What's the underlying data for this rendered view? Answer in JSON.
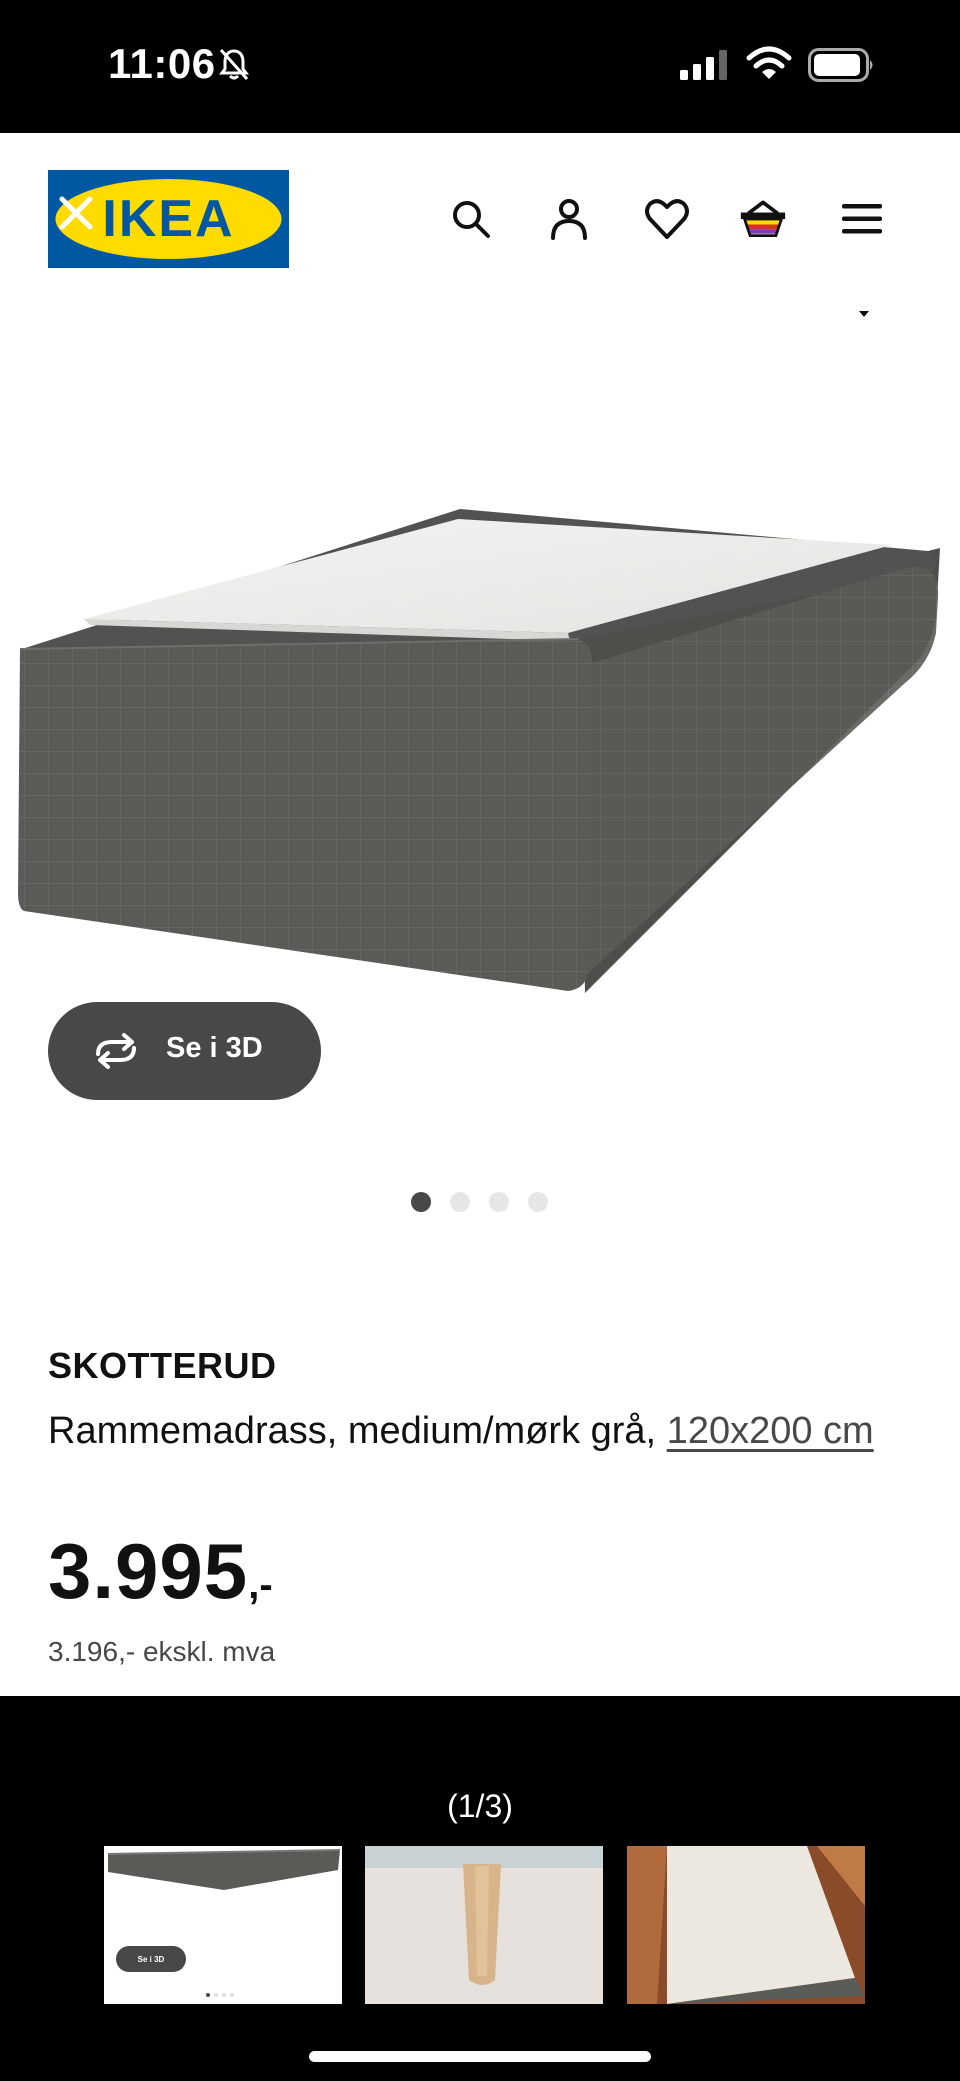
{
  "status_bar": {
    "time": "11:06",
    "icons": [
      "bell-slash-icon",
      "cellular-signal-icon",
      "wifi-icon",
      "battery-icon"
    ]
  },
  "header": {
    "logo_text": "IKEA",
    "icons": [
      "close-icon",
      "search-icon",
      "account-icon",
      "heart-icon",
      "cart-icon",
      "menu-icon"
    ],
    "colors": {
      "logo_blue": "#0058A3",
      "logo_yellow": "#FFDB00"
    }
  },
  "product": {
    "see_3d_label": "Se i 3D",
    "image_count": 4,
    "active_image": 1,
    "name": "SKOTTERUD",
    "description": "Rammemadrass, medium/mørk grå,",
    "size_link": "120x200 cm",
    "price_integer": "3.995",
    "price_suffix": ",-",
    "price_ex_vat": "3.196,- ekskl. mva"
  },
  "gallery": {
    "counter": "(1/3)",
    "thumbnails": [
      {
        "label": "Se i 3D"
      },
      {
        "label": ""
      },
      {
        "label": ""
      }
    ]
  }
}
